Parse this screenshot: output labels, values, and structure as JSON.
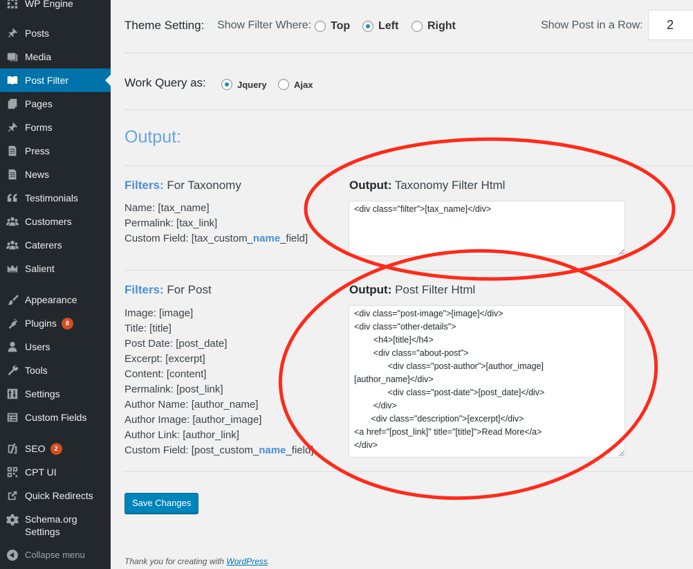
{
  "sidebar": {
    "items": [
      {
        "label": "WP Engine",
        "icon": "wp-engine-icon"
      },
      {
        "label": "Posts",
        "icon": "pushpin-icon"
      },
      {
        "label": "Media",
        "icon": "media-icon"
      },
      {
        "label": "Post Filter",
        "icon": "book-icon",
        "active": true
      },
      {
        "label": "Pages",
        "icon": "pages-icon"
      },
      {
        "label": "Forms",
        "icon": "pushpin-icon"
      },
      {
        "label": "Press",
        "icon": "document-icon"
      },
      {
        "label": "News",
        "icon": "document-icon"
      },
      {
        "label": "Testimonials",
        "icon": "quote-icon"
      },
      {
        "label": "Customers",
        "icon": "groups-icon"
      },
      {
        "label": "Caterers",
        "icon": "groups-icon"
      },
      {
        "label": "Salient",
        "icon": "crown-icon"
      },
      {
        "label": "Appearance",
        "icon": "paintbrush-icon"
      },
      {
        "label": "Plugins",
        "icon": "plugin-icon",
        "badge": "8"
      },
      {
        "label": "Users",
        "icon": "user-icon"
      },
      {
        "label": "Tools",
        "icon": "wrench-icon"
      },
      {
        "label": "Settings",
        "icon": "settings-icon"
      },
      {
        "label": "Custom Fields",
        "icon": "table-icon"
      },
      {
        "label": "SEO",
        "icon": "yoast-icon",
        "badge": "2"
      },
      {
        "label": "CPT UI",
        "icon": "grid-icon"
      },
      {
        "label": "Quick Redirects",
        "icon": "external-link-icon"
      },
      {
        "label": "Schema.org Settings",
        "icon": "gear-icon"
      }
    ],
    "collapse_label": "Collapse menu"
  },
  "theme_setting": {
    "label": "Theme Setting:",
    "show_filter_label": "Show Filter Where:",
    "options": [
      "Top",
      "Left",
      "Right"
    ],
    "selected": "Left",
    "posts_row_label": "Show Post in a Row:",
    "posts_row_value": "2"
  },
  "work_query": {
    "label": "Work Query as:",
    "options": [
      "Jquery",
      "Ajax"
    ],
    "selected": "Jquery"
  },
  "output_section": {
    "title": "Output:"
  },
  "taxonomy": {
    "filters_prefix": "Filters:",
    "filters_label": "For Taxonomy",
    "fields": [
      "Name: [tax_name]",
      "Permalink: [tax_link]"
    ],
    "custom_field": {
      "pre": "Custom Field: [tax_custom_",
      "hl": "name",
      "post": "_field]"
    },
    "output_prefix": "Output:",
    "output_label": "Taxonomy Filter Html",
    "textarea_value": "<div class=\"filter\">[tax_name]</div>"
  },
  "post": {
    "filters_prefix": "Filters:",
    "filters_label": "For Post",
    "fields": [
      "Image: [image]",
      "Title: [title]",
      "Post Date: [post_date]",
      "Excerpt: [excerpt]",
      "Content: [content]",
      "Permalink: [post_link]",
      "Author Name: [author_name]",
      "Author Image: [author_image]",
      "Author Link: [author_link]"
    ],
    "custom_field": {
      "pre": "Custom Field: [post_custom_",
      "hl": "name",
      "post": "_field]"
    },
    "output_prefix": "Output:",
    "output_label": "Post Filter Html",
    "textarea_value": "<div class=\"post-image\">[image]</div>\n<div class=\"other-details\">\n        <h4>[title]</h4>\n        <div class=\"about-post\">\n              <div class=\"post-author\">[author_image]\n[author_name]</div>\n              <div class=\"post-date\">[post_date]</div>\n        </div>\n       <div class=\"description\">[excerpt]</div>\n<a href=\"[post_link]\" title=\"[title]\">Read More</a>\n</div>"
  },
  "save_button": "Save Changes",
  "footer": {
    "text": "Thank you for creating with ",
    "link": "WordPress",
    "suffix": "."
  },
  "colors": {
    "sidebar_bg": "#23282d",
    "active_bg": "#0073aa",
    "accent_blue": "#4a8fd8",
    "annotation_red": "#ff2a1a",
    "badge": "#d54e21"
  }
}
